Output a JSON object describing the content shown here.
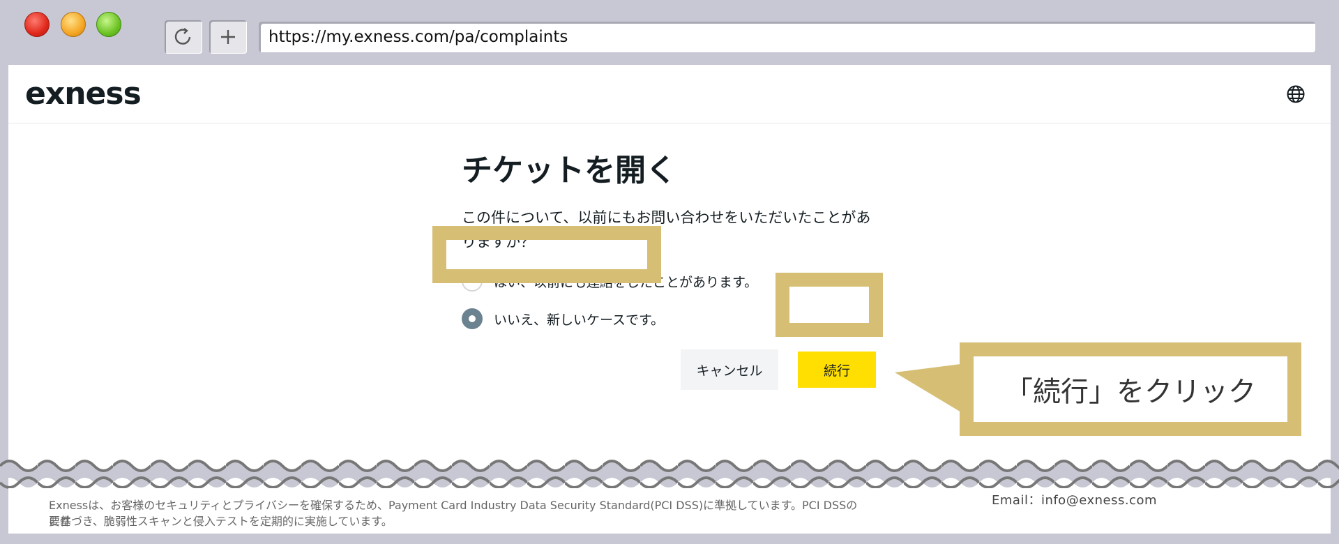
{
  "browser": {
    "url": "https://my.exness.com/pa/complaints",
    "reload_icon": "reload-icon",
    "new_tab_icon": "plus-icon"
  },
  "header": {
    "logo": "exness",
    "language_icon": "globe-icon"
  },
  "form": {
    "title": "チケットを開く",
    "question": "この件について、以前にもお問い合わせをいただいたことがありますか？",
    "options": [
      {
        "label": "はい、以前にも連絡をしたことがあります。",
        "checked": false
      },
      {
        "label": "いいえ、新しいケースです。",
        "checked": true
      }
    ],
    "cancel_label": "キャンセル",
    "continue_label": "続行"
  },
  "callout": {
    "text": "「続行」をクリック"
  },
  "footer": {
    "security_line1": "Exnessは、お客様のセキュリティとプライバシーを確保するため、Payment Card Industry Data Security Standard(PCI DSS)に準拠しています。PCI DSSの要件",
    "security_line2": "に基づき、脆弱性スキャンと侵入テストを定期的に実施しています。",
    "email": "Email：info@exness.com"
  },
  "colors": {
    "accent_yellow": "#ffde02",
    "highlight": "#d6bf74",
    "radio_checked": "#6b8290",
    "text_dark": "#141d22"
  }
}
